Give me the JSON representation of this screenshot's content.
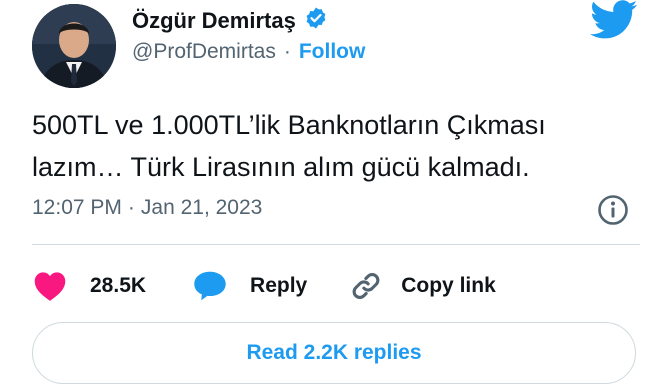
{
  "author": {
    "name": "Özgür Demirtaş",
    "handle": "@ProfDemirtas",
    "separator": "·",
    "follow_label": "Follow",
    "verified": true
  },
  "tweet": {
    "text_lines": [
      "500TL ve 1.000TL’lik Banknotların Çıkması",
      "lazım… Türk Lirasının alım gücü kalmadı."
    ],
    "time": "12:07 PM",
    "separator": "·",
    "date": "Jan 21, 2023"
  },
  "actions": {
    "likes_count": "28.5K",
    "reply_label": "Reply",
    "copy_link_label": "Copy link"
  },
  "read_replies_label": "Read 2.2K replies",
  "icons": {
    "brand": "twitter-bird-icon",
    "verified": "verified-badge-icon",
    "info": "info-icon",
    "like": "heart-icon",
    "reply": "speech-bubble-icon",
    "copy_link": "link-icon"
  },
  "colors": {
    "accent": "#1d9bf0",
    "like": "#f91880",
    "secondary_text": "#536471"
  }
}
